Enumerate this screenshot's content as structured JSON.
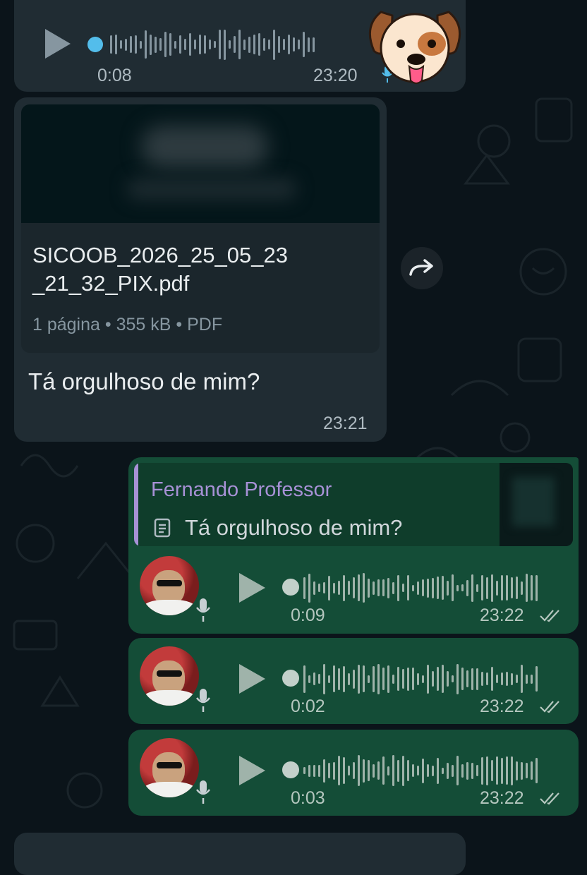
{
  "chat": {
    "incoming_audio": {
      "duration": "0:08",
      "time": "23:20",
      "sticker": "dog-face-sticker"
    },
    "document_message": {
      "file_name_line1": "SICOOB_2026_25_05_23",
      "file_name_line2": "_21_32_PIX.pdf",
      "pages": "1 página",
      "size": "355 kB",
      "type": "PDF",
      "caption": "Tá orgulhoso de mim?",
      "time": "23:21"
    },
    "reply": {
      "author": "Fernando Professor",
      "quoted_text": "Tá orgulhoso de mim?"
    },
    "outgoing_audios": [
      {
        "duration": "0:09",
        "time": "23:22"
      },
      {
        "duration": "0:02",
        "time": "23:22"
      },
      {
        "duration": "0:03",
        "time": "23:22"
      }
    ],
    "icons": {
      "forward": "forward-icon",
      "doc": "document-icon",
      "read": "double-check-icon",
      "mic": "mic-icon"
    }
  },
  "colors": {
    "background": "#0b141a",
    "incoming_bubble": "#202c33",
    "outgoing_bubble": "#144d37",
    "reply_author": "#a791d6",
    "played_dot": "#53bdeb"
  }
}
